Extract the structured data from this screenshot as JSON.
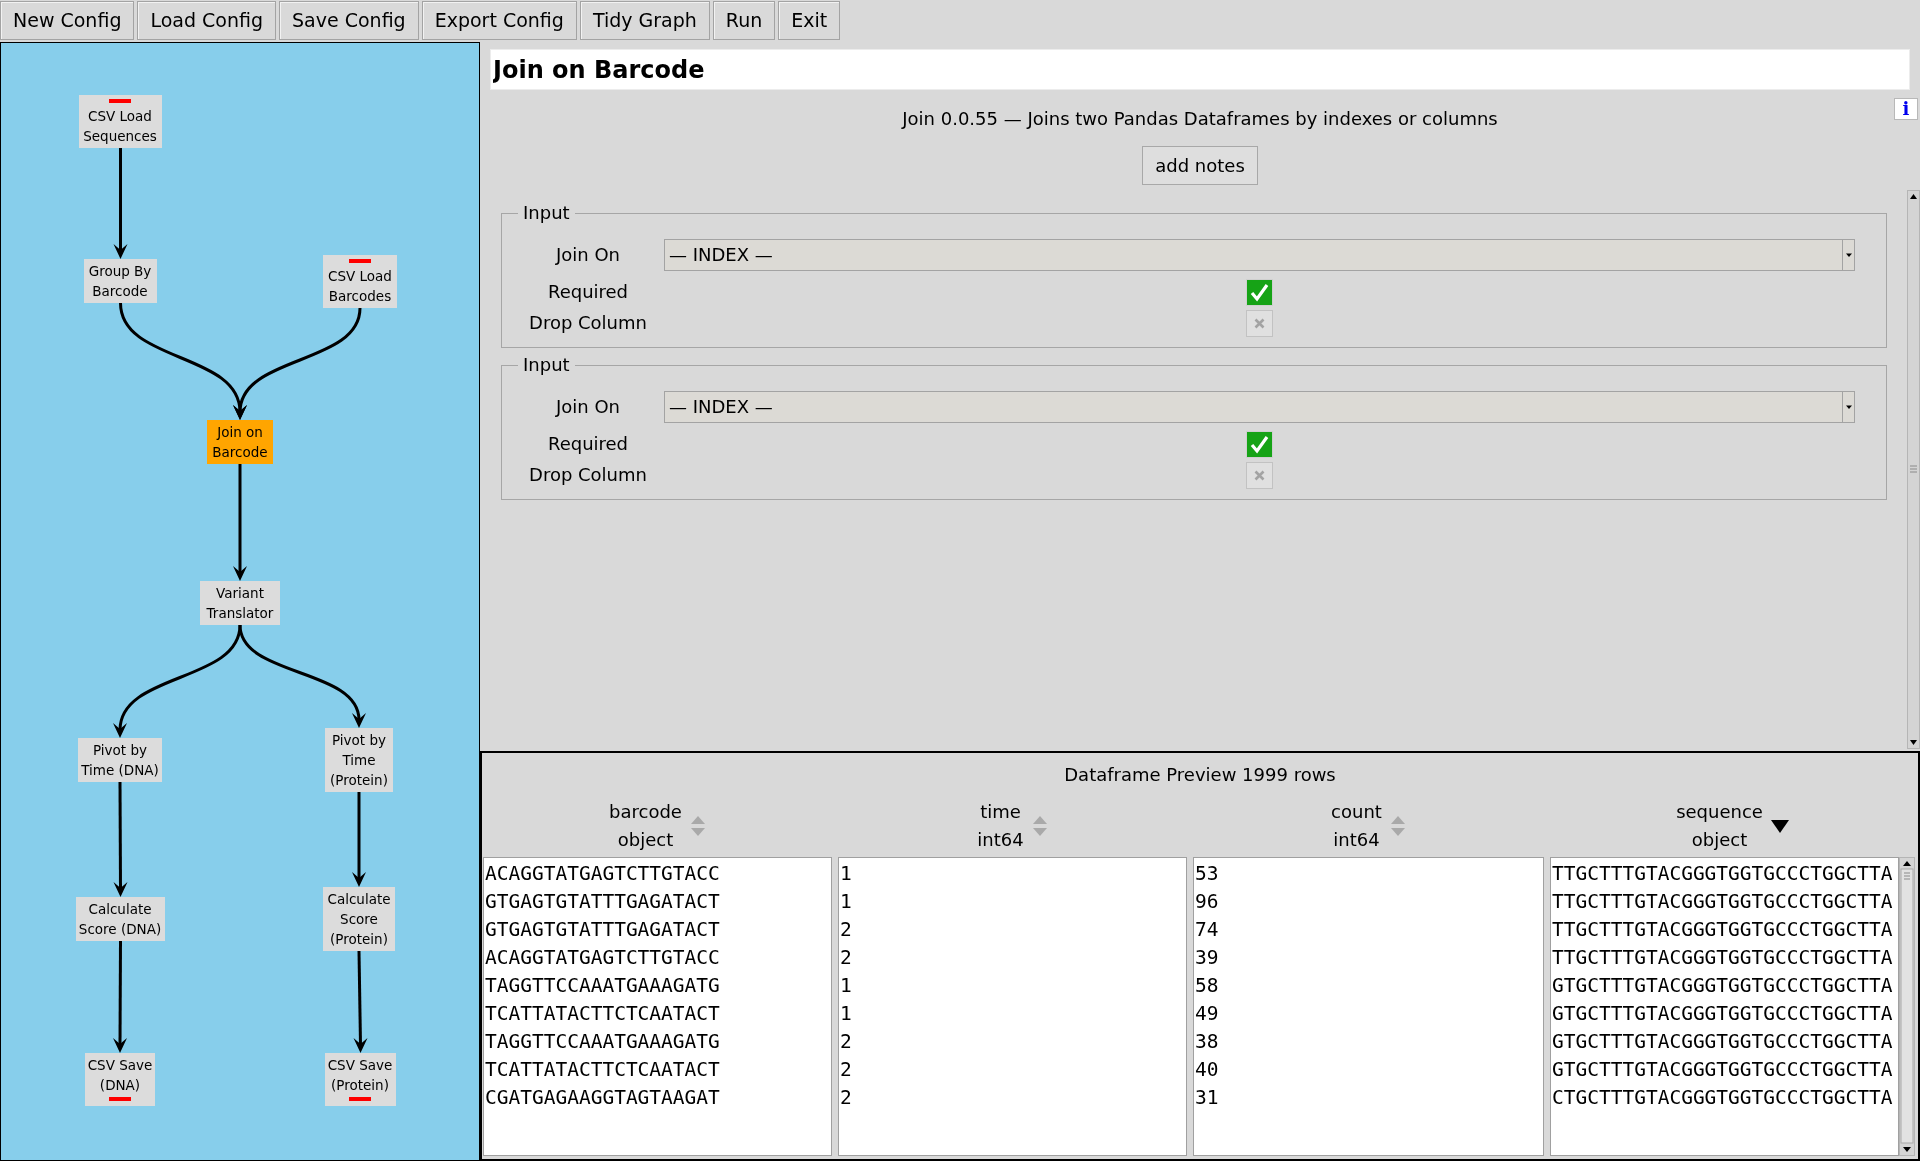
{
  "toolbar": {
    "buttons": [
      "New Config",
      "Load Config",
      "Save Config",
      "Export Config",
      "Tidy Graph",
      "Run",
      "Exit"
    ]
  },
  "graph": {
    "nodes": [
      {
        "label": "CSV Load Sequences",
        "kind": "source",
        "selected": false
      },
      {
        "label": "Group By Barcode",
        "kind": "step",
        "selected": false
      },
      {
        "label": "CSV Load Barcodes",
        "kind": "source",
        "selected": false
      },
      {
        "label": "Join on Barcode",
        "kind": "step",
        "selected": true
      },
      {
        "label": "Variant Translator",
        "kind": "step",
        "selected": false
      },
      {
        "label": "Pivot by Time (DNA)",
        "kind": "step",
        "selected": false
      },
      {
        "label": "Pivot by Time (Protein)",
        "kind": "step",
        "selected": false
      },
      {
        "label": "Calculate Score (DNA)",
        "kind": "step",
        "selected": false
      },
      {
        "label": "Calculate Score (Protein)",
        "kind": "step",
        "selected": false
      },
      {
        "label": "CSV Save (DNA)",
        "kind": "sink",
        "selected": false
      },
      {
        "label": "CSV Save (Protein)",
        "kind": "sink",
        "selected": false
      }
    ]
  },
  "node_panel": {
    "title": "Join on Barcode",
    "info_button": "i",
    "description": "Join 0.0.55 — Joins two Pandas Dataframes by indexes or columns",
    "notes_button": "add notes",
    "input_groups": [
      {
        "legend": "Input",
        "fields": [
          {
            "kind": "select",
            "label": "Join On",
            "value": "— INDEX —"
          },
          {
            "kind": "checkbox",
            "label": "Required",
            "checked": true,
            "disabled": false
          },
          {
            "kind": "checkbox",
            "label": "Drop Column",
            "checked": false,
            "disabled": true
          }
        ]
      },
      {
        "legend": "Input",
        "fields": [
          {
            "kind": "select",
            "label": "Join On",
            "value": "— INDEX —"
          },
          {
            "kind": "checkbox",
            "label": "Required",
            "checked": true,
            "disabled": false
          },
          {
            "kind": "checkbox",
            "label": "Drop Column",
            "checked": false,
            "disabled": true
          }
        ]
      }
    ]
  },
  "preview": {
    "title": "Dataframe Preview 1999 rows",
    "columns": [
      {
        "name": "barcode",
        "dtype": "object",
        "sort_descending": false,
        "values": [
          "ACAGGTATGAGTCTTGTACC",
          "GTGAGTGTATTTGAGATACT",
          "GTGAGTGTATTTGAGATACT",
          "ACAGGTATGAGTCTTGTACC",
          "TAGGTTCCAAATGAAAGATG",
          "TCATTATACTTCTCAATACT",
          "TAGGTTCCAAATGAAAGATG",
          "TCATTATACTTCTCAATACT",
          "CGATGAGAAGGTAGTAAGAT"
        ]
      },
      {
        "name": "time",
        "dtype": "int64",
        "sort_descending": false,
        "values": [
          "1",
          "1",
          "2",
          "2",
          "1",
          "1",
          "2",
          "2",
          "2"
        ]
      },
      {
        "name": "count",
        "dtype": "int64",
        "sort_descending": false,
        "values": [
          "53",
          "96",
          "74",
          "39",
          "58",
          "49",
          "38",
          "40",
          "31"
        ]
      },
      {
        "name": "sequence",
        "dtype": "object",
        "sort_descending": true,
        "values": [
          "TTGCTTTGTACGGGTGGTGCCCTGGCTTA",
          "TTGCTTTGTACGGGTGGTGCCCTGGCTTA",
          "TTGCTTTGTACGGGTGGTGCCCTGGCTTA",
          "TTGCTTTGTACGGGTGGTGCCCTGGCTTA",
          "GTGCTTTGTACGGGTGGTGCCCTGGCTTA",
          "GTGCTTTGTACGGGTGGTGCCCTGGCTTA",
          "GTGCTTTGTACGGGTGGTGCCCTGGCTTA",
          "GTGCTTTGTACGGGTGGTGCCCTGGCTTA",
          "CTGCTTTGTACGGGTGGTGCCCTGGCTTA"
        ]
      }
    ]
  }
}
